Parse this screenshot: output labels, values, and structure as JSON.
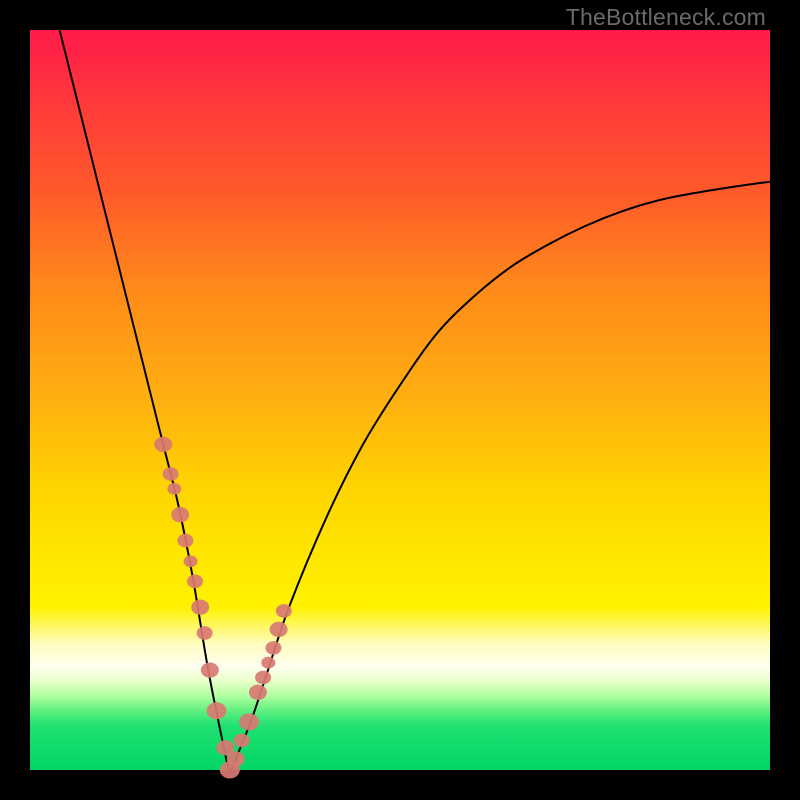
{
  "watermark": "TheBottleneck.com",
  "chart_data": {
    "type": "line",
    "title": "",
    "xlabel": "",
    "ylabel": "",
    "xlim": [
      0,
      100
    ],
    "ylim": [
      0,
      100
    ],
    "grid": false,
    "legend": false,
    "description": "Bottleneck percentage curve over a red-to-green vertical gradient. V-shaped curve with minimum near x≈27. Salmon markers cluster on the lower flanks of the V.",
    "series": [
      {
        "name": "bottleneck-curve",
        "x": [
          4,
          6,
          8,
          10,
          12,
          14,
          16,
          18,
          20,
          22,
          24,
          26,
          27,
          28,
          30,
          32,
          35,
          40,
          45,
          50,
          55,
          60,
          65,
          70,
          75,
          80,
          85,
          90,
          95,
          100
        ],
        "y": [
          100,
          92,
          84,
          76,
          68,
          60,
          52,
          44,
          36,
          26,
          14,
          4,
          0,
          2,
          7,
          13,
          22,
          34,
          44,
          52,
          59,
          64,
          68,
          71,
          73.5,
          75.5,
          77,
          78,
          78.8,
          79.5
        ]
      }
    ],
    "markers": {
      "name": "highlight-beads",
      "x": [
        18,
        19,
        19.5,
        20.3,
        21,
        21.7,
        22.3,
        23,
        23.6,
        24.3,
        25.2,
        26.4,
        27,
        27.8,
        28.6,
        29.6,
        30.8,
        31.5,
        32.2,
        32.9,
        33.6,
        34.3
      ],
      "y": [
        44,
        40,
        38,
        34.5,
        31,
        28.2,
        25.5,
        22,
        18.5,
        13.5,
        8,
        3,
        0,
        1.5,
        4,
        6.5,
        10.5,
        12.5,
        14.5,
        16.5,
        19,
        21.5
      ],
      "r": [
        9,
        8,
        7,
        9,
        8,
        7,
        8,
        9,
        8,
        9,
        10,
        9,
        10,
        9,
        8,
        10,
        9,
        8,
        7,
        8,
        9,
        8
      ]
    },
    "gradient_stops": [
      {
        "pos": 0,
        "color": "#ff1a4a"
      },
      {
        "pos": 50,
        "color": "#ffd400"
      },
      {
        "pos": 86,
        "color": "#fffff0"
      },
      {
        "pos": 100,
        "color": "#00d666"
      }
    ]
  }
}
